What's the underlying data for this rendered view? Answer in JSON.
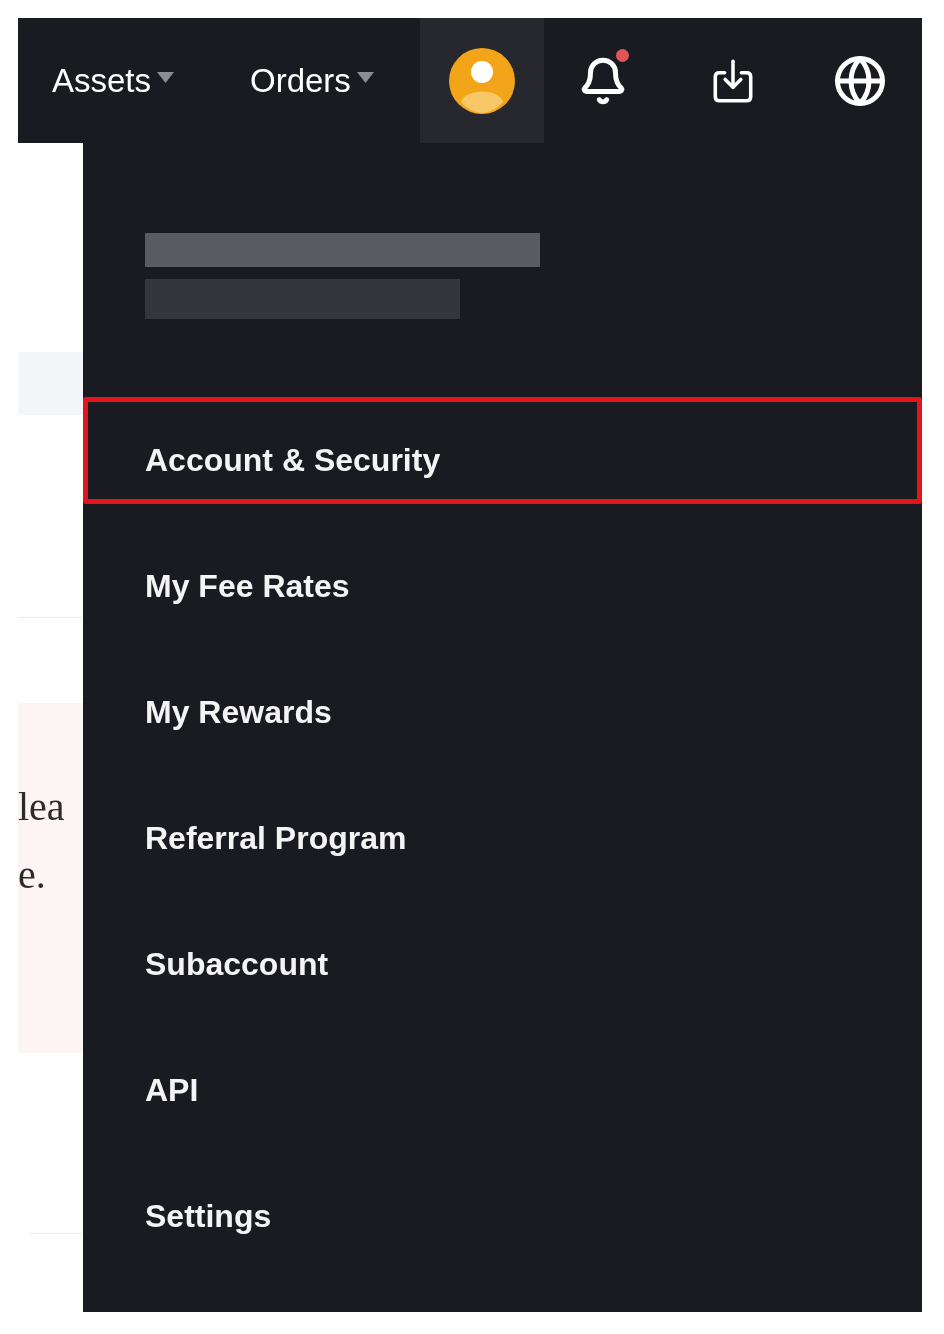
{
  "navbar": {
    "menus": [
      {
        "label": "Assets"
      },
      {
        "label": "Orders"
      }
    ],
    "account_button": {
      "selected": true
    },
    "notifications": {
      "unread": true
    }
  },
  "page": {
    "notice_lines": [
      "lea",
      "e."
    ]
  },
  "account_menu": {
    "items": [
      {
        "label": "Account & Security",
        "highlighted": true
      },
      {
        "label": "My Fee Rates",
        "highlighted": false
      },
      {
        "label": "My Rewards",
        "highlighted": false
      },
      {
        "label": "Referral Program",
        "highlighted": false
      },
      {
        "label": "Subaccount",
        "highlighted": false
      },
      {
        "label": "API",
        "highlighted": false
      },
      {
        "label": "Settings",
        "highlighted": false
      }
    ]
  }
}
